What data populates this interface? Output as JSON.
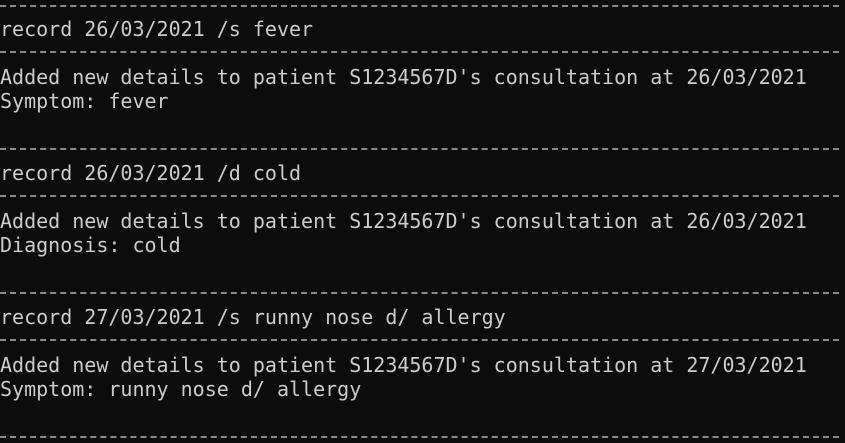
{
  "terminal": {
    "blocks": [
      {
        "command": "record 26/03/2021 /s fever",
        "response": [
          "Added new details to patient S1234567D's consultation at 26/03/2021",
          "Symptom: fever"
        ]
      },
      {
        "command": "record 26/03/2021 /d cold",
        "response": [
          "Added new details to patient S1234567D's consultation at 26/03/2021",
          "Diagnosis: cold"
        ]
      },
      {
        "command": "record 27/03/2021 /s runny nose d/ allergy",
        "response": [
          "Added new details to patient S1234567D's consultation at 27/03/2021",
          "Symptom: runny nose d/ allergy"
        ]
      }
    ]
  }
}
